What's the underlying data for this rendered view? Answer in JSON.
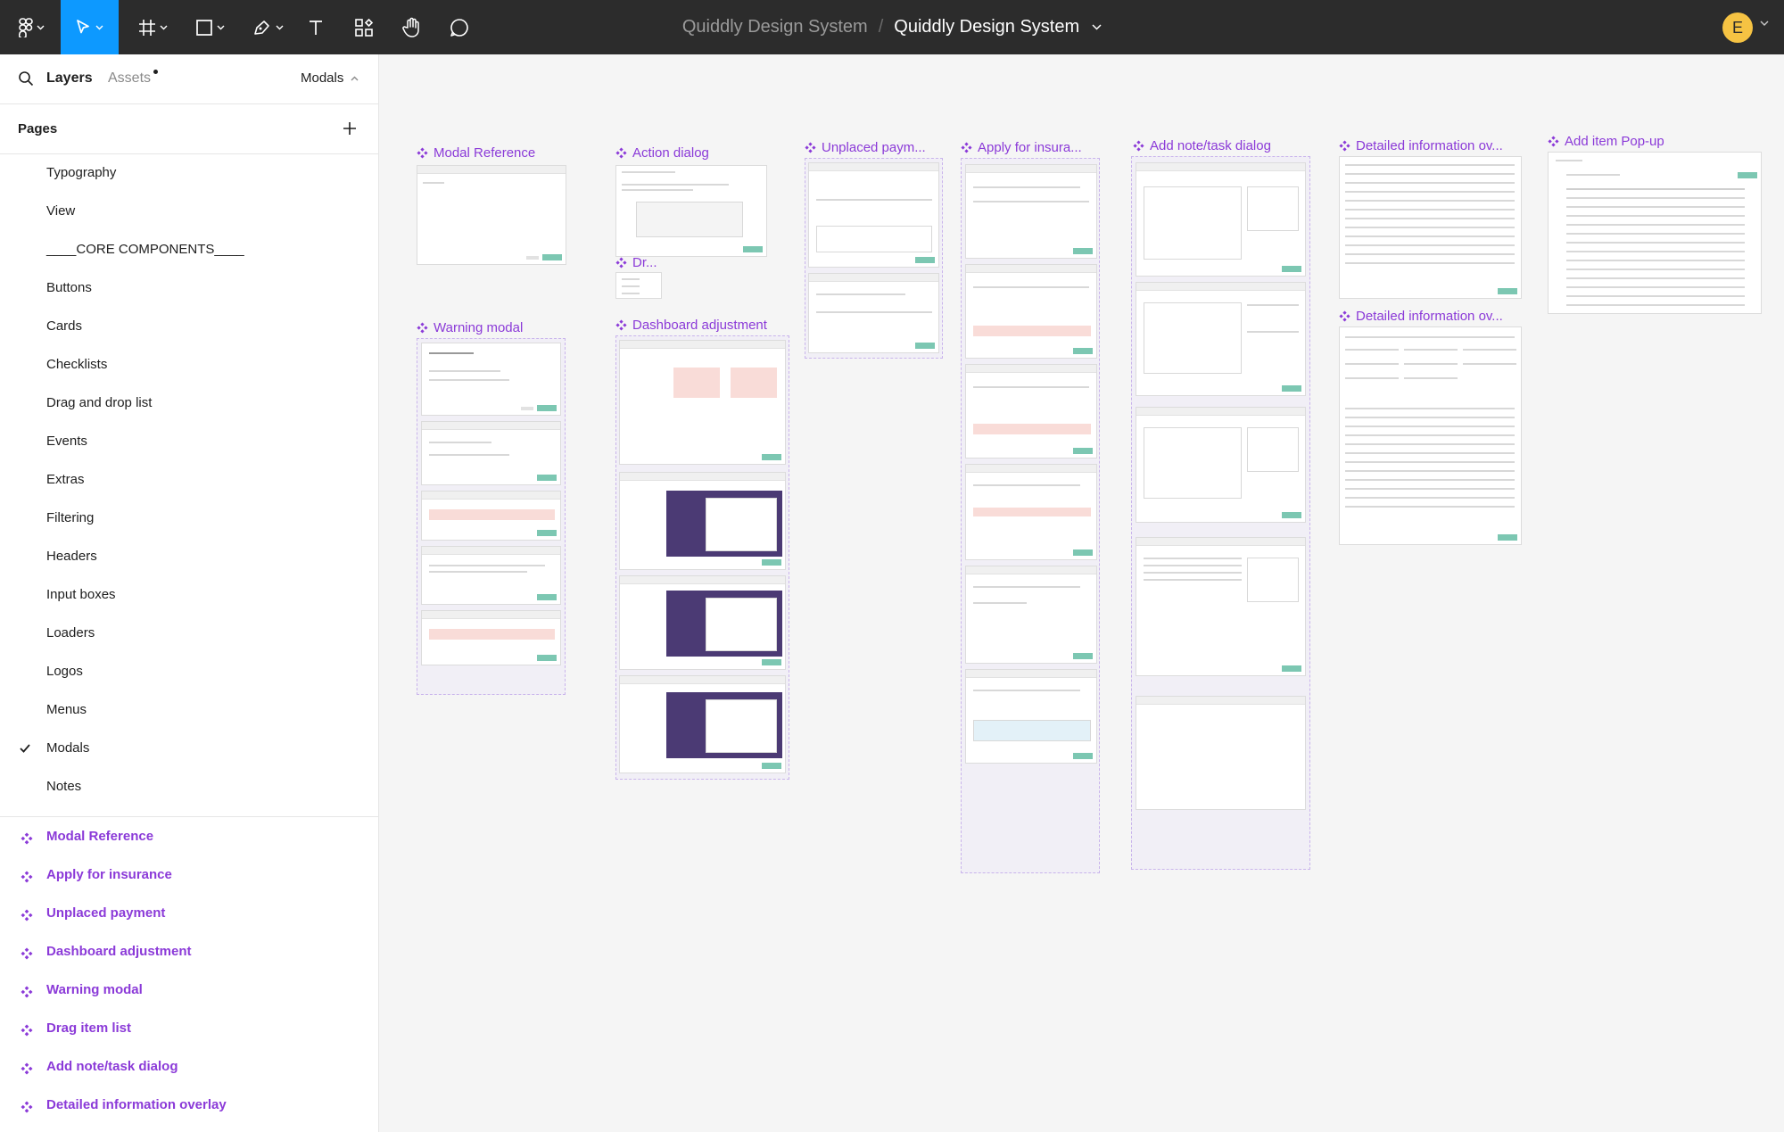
{
  "toolbar": {
    "tools": [
      "figma-menu",
      "move",
      "frame",
      "shape",
      "pen",
      "text",
      "components",
      "hand",
      "comment"
    ],
    "active_tool": "move",
    "accent": "#0d99ff",
    "background": "#2c2c2c"
  },
  "breadcrumb": {
    "project": "Quiddly Design System",
    "separator": "/",
    "file": "Quiddly Design System"
  },
  "user": {
    "avatar_initial": "E",
    "avatar_color": "#f6c343"
  },
  "left_panel": {
    "tab_layers": "Layers",
    "tab_assets": "Assets",
    "current_page": "Modals",
    "pages_title": "Pages",
    "pages": [
      "Typography",
      "View",
      "____CORE COMPONENTS____",
      "Buttons",
      "Cards",
      "Checklists",
      "Drag and drop list",
      "Events",
      "Extras",
      "Filtering",
      "Headers",
      "Input boxes",
      "Loaders",
      "Logos",
      "Menus",
      "Modals",
      "Notes"
    ],
    "selected_page": "Modals",
    "layers": [
      "Modal Reference",
      "Apply for insurance",
      "Unplaced payment",
      "Dashboard adjustment",
      "Warning modal",
      "Drag item list",
      "Add note/task dialog",
      "Detailed information overlay"
    ],
    "component_color": "#8b3ad8"
  },
  "canvas": {
    "frames": {
      "modal_reference": "Modal Reference",
      "action_dialog": "Action dialog",
      "drag": "Dr...",
      "warning_modal": "Warning modal",
      "dashboard_adjustment": "Dashboard adjustment",
      "unplaced_payment": "Unplaced paym...",
      "apply_insurance": "Apply for insura...",
      "add_note": "Add note/task dialog",
      "detailed_info_1": "Detailed information ov...",
      "detailed_info_2": "Detailed information ov...",
      "add_item": "Add item Pop-up"
    }
  }
}
